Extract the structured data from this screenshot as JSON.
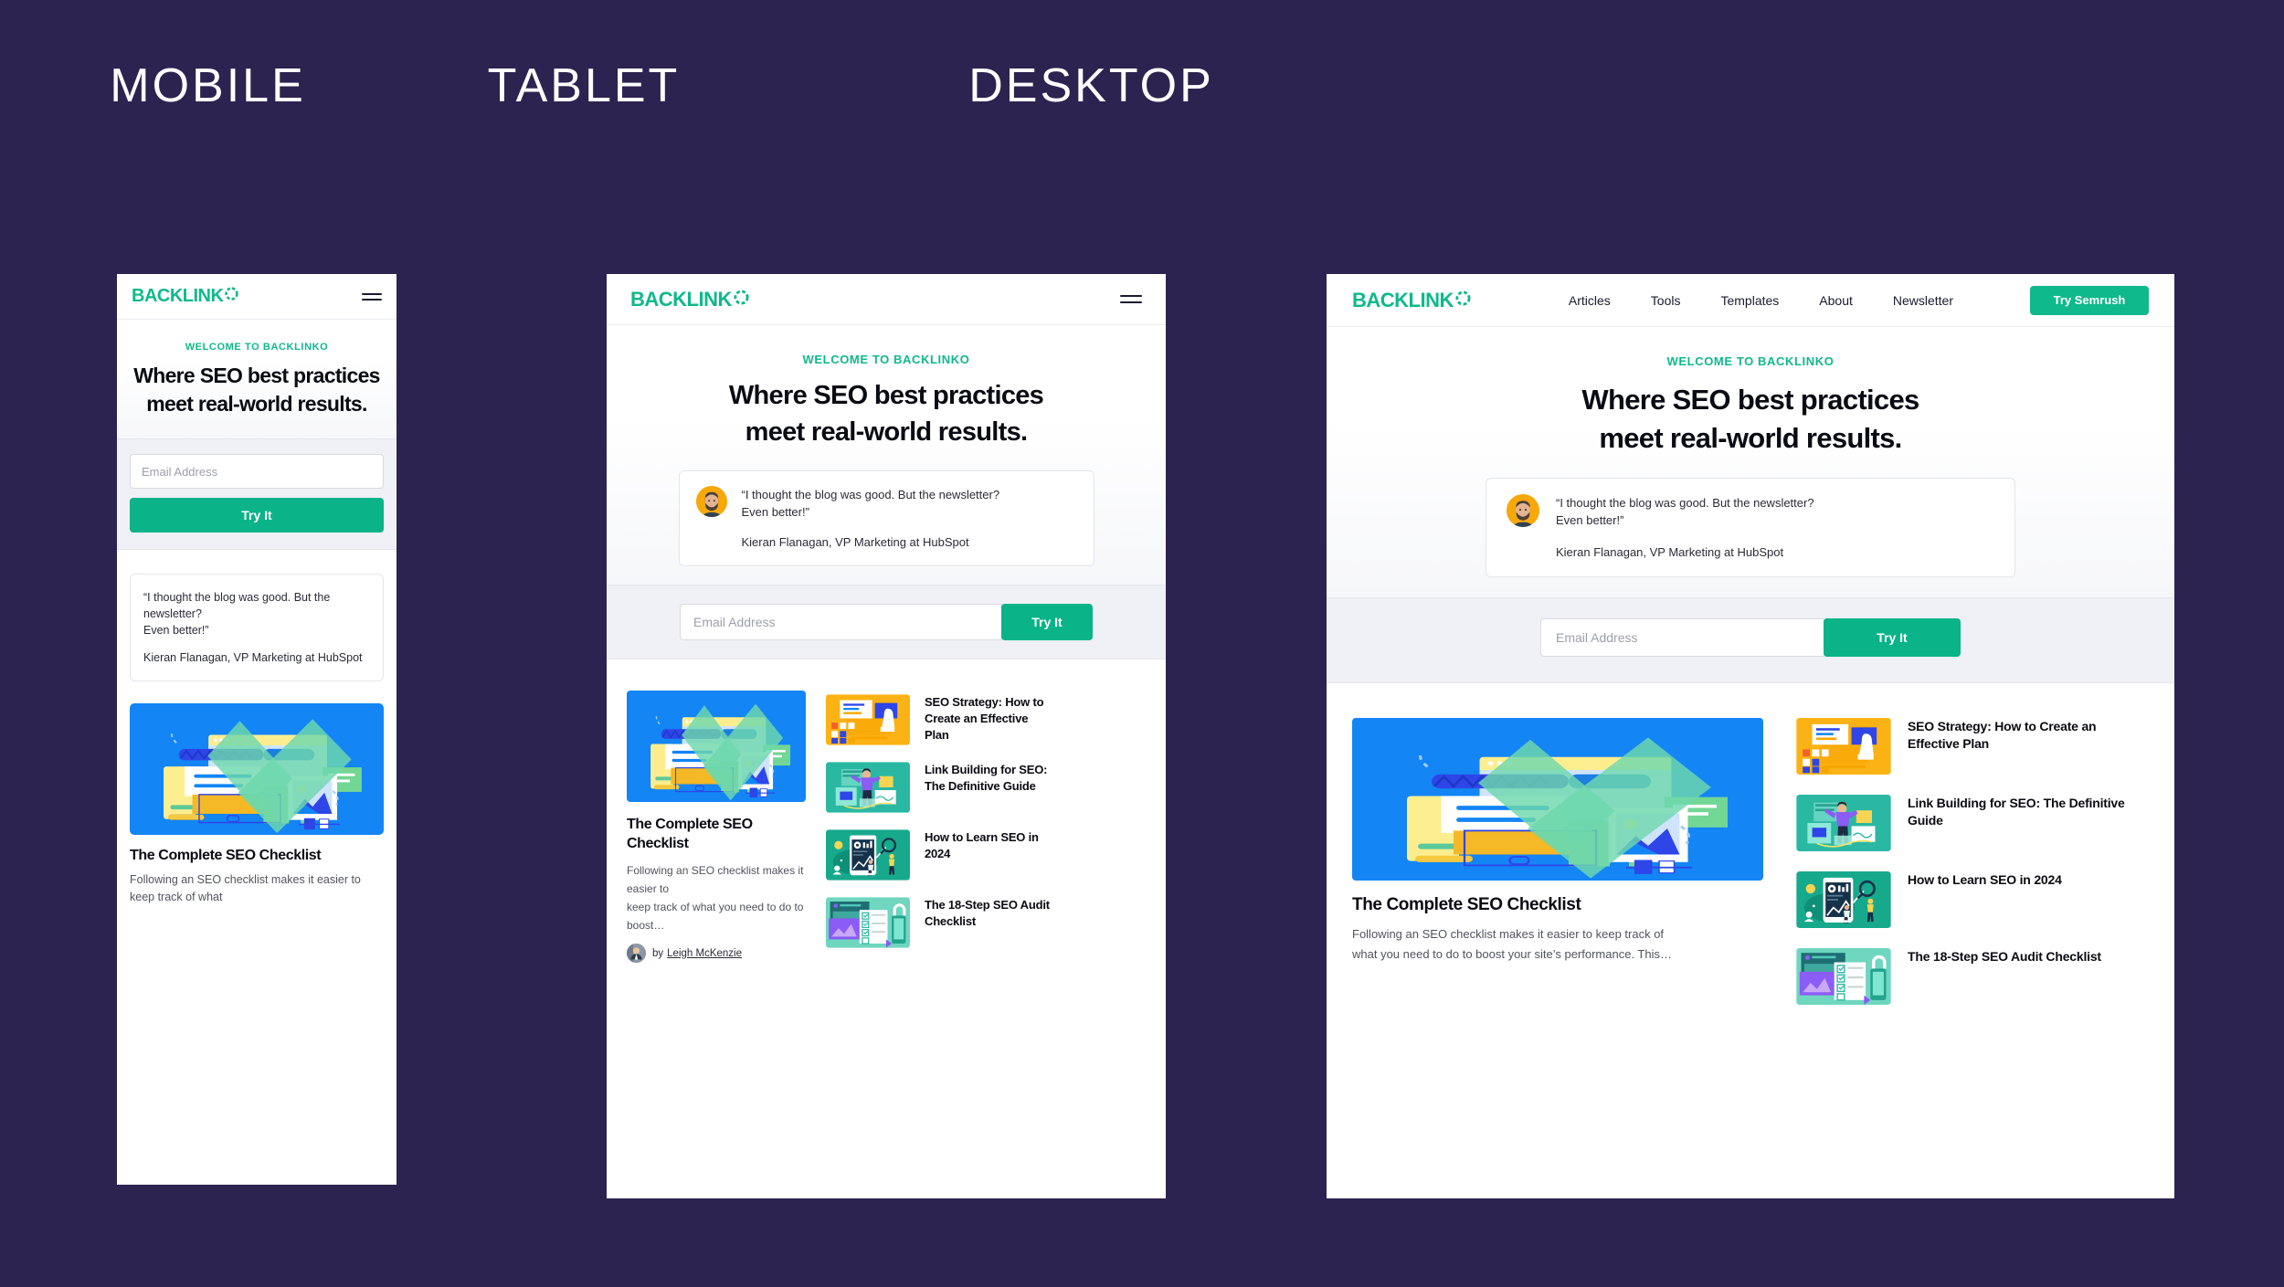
{
  "page": {
    "background_color": "#2D2350",
    "accent_color": "#0FB98B",
    "labels": [
      {
        "id": "mobile",
        "text": "MOBILE"
      },
      {
        "id": "tablet",
        "text": "TABLET"
      },
      {
        "id": "desktop",
        "text": "DESKTOP"
      }
    ]
  },
  "brand": {
    "logo_text": "BACKLINK",
    "logo_suffix_icon": "dashed-circle-o",
    "logo_color": "#0FB98B"
  },
  "nav": {
    "links": [
      {
        "label": "Articles"
      },
      {
        "label": "Tools"
      },
      {
        "label": "Templates"
      },
      {
        "label": "About"
      },
      {
        "label": "Newsletter"
      }
    ],
    "cta": {
      "label": "Try Semrush",
      "color": "#0FB98B"
    },
    "menu_icon": "hamburger-icon"
  },
  "hero": {
    "eyebrow": "WELCOME TO BACKLINKO",
    "headline_line1": "Where SEO best practices",
    "headline_line2": "meet real-world results."
  },
  "testimonial": {
    "avatar_icon": "avatar-kieran-flanagan",
    "avatar_bg": "#F7A80B",
    "quote_line1": "“I thought the blog was good. But the newsletter?",
    "quote_line2": "Even better!”",
    "attribution": "Kieran Flanagan, VP Marketing at HubSpot"
  },
  "signup": {
    "email_placeholder": "Email Address",
    "email_value": "",
    "submit_label": "Try It",
    "submit_color": "#0AB388"
  },
  "featured_article": {
    "thumbnail_icon": "seo-checklist-illustration",
    "title": "The Complete SEO Checklist",
    "excerpt_mobile": "Following an SEO checklist makes it easier to keep track of what",
    "excerpt_tablet_line1": "Following an SEO checklist makes it easier to",
    "excerpt_tablet_line2": "keep track of what you need to do to boost…",
    "excerpt_desktop_line1": "Following an SEO checklist makes it easier to keep track of",
    "excerpt_desktop_line2": "what you need to do to boost your site’s performance. This…",
    "byline_prefix": "by",
    "byline_author": "Leigh McKenzie",
    "byline_avatar_icon": "avatar-leigh-mckenzie"
  },
  "article_list": [
    {
      "thumbnail_icon": "seo-strategy-illustration",
      "thumbnail_color": "#FBB214",
      "title": "SEO Strategy: How to Create an Effective Plan",
      "title_tablet_lines": [
        "SEO Strategy: How to",
        "Create an Effective",
        "Plan"
      ],
      "title_desktop_lines": [
        "SEO Strategy: How to Create an",
        "Effective Plan"
      ]
    },
    {
      "thumbnail_icon": "link-building-illustration",
      "thumbnail_color": "#2BB8A3",
      "title": "Link Building for SEO: The Definitive Guide",
      "title_tablet_lines": [
        "Link Building for SEO:",
        "The Definitive Guide"
      ],
      "title_desktop_lines": [
        "Link Building for SEO: The Definitive",
        "Guide"
      ]
    },
    {
      "thumbnail_icon": "learn-seo-illustration",
      "thumbnail_color": "#17A98C",
      "title": "How to Learn SEO in 2024",
      "title_tablet_lines": [
        "How to Learn SEO in",
        "2024"
      ],
      "title_desktop_lines": [
        "How to Learn SEO in 2024"
      ]
    },
    {
      "thumbnail_icon": "seo-audit-illustration",
      "thumbnail_color": "#6FD6C0",
      "title": "The 18-Step SEO Audit Checklist",
      "title_tablet_lines": [
        "The 18-Step SEO Audit",
        "Checklist"
      ],
      "title_desktop_lines": [
        "The 18-Step SEO Audit Checklist"
      ]
    }
  ]
}
